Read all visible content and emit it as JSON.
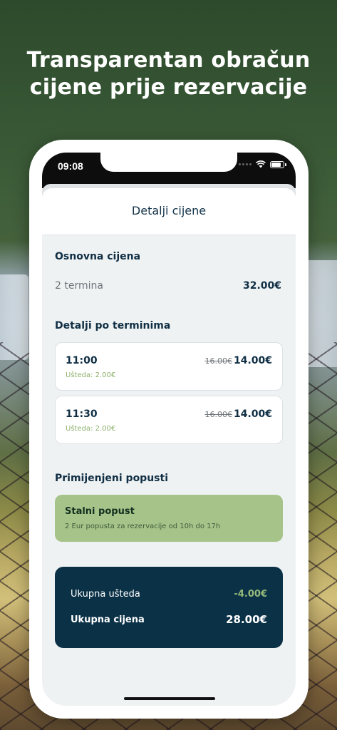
{
  "headline": {
    "line1": "Transparentan obračun",
    "line2": "cijene prije rezervacije"
  },
  "status_bar": {
    "time": "09:08"
  },
  "screen": {
    "title": "Detalji cijene",
    "base_price": {
      "section_title": "Osnovna cijena",
      "label": "2 termina",
      "value": "32.00€"
    },
    "slots": {
      "section_title": "Detalji po terminima",
      "items": [
        {
          "time": "11:00",
          "old_price": "16.00€",
          "new_price": "14.00€",
          "saving": "Ušteda: 2.00€"
        },
        {
          "time": "11:30",
          "old_price": "16.00€",
          "new_price": "14.00€",
          "saving": "Ušteda: 2.00€"
        }
      ]
    },
    "discounts": {
      "section_title": "Primijenjeni popusti",
      "items": [
        {
          "title": "Stalni popust",
          "description": "2 Eur popusta za rezervacije od 10h do 17h"
        }
      ]
    },
    "totals": {
      "saving_label": "Ukupna ušteda",
      "saving_value": "-4.00€",
      "price_label": "Ukupna cijena",
      "price_value": "28.00€"
    }
  },
  "colors": {
    "navy": "#0b3147",
    "accent_green": "#a6c48a",
    "saving_green": "#8bb06a"
  }
}
